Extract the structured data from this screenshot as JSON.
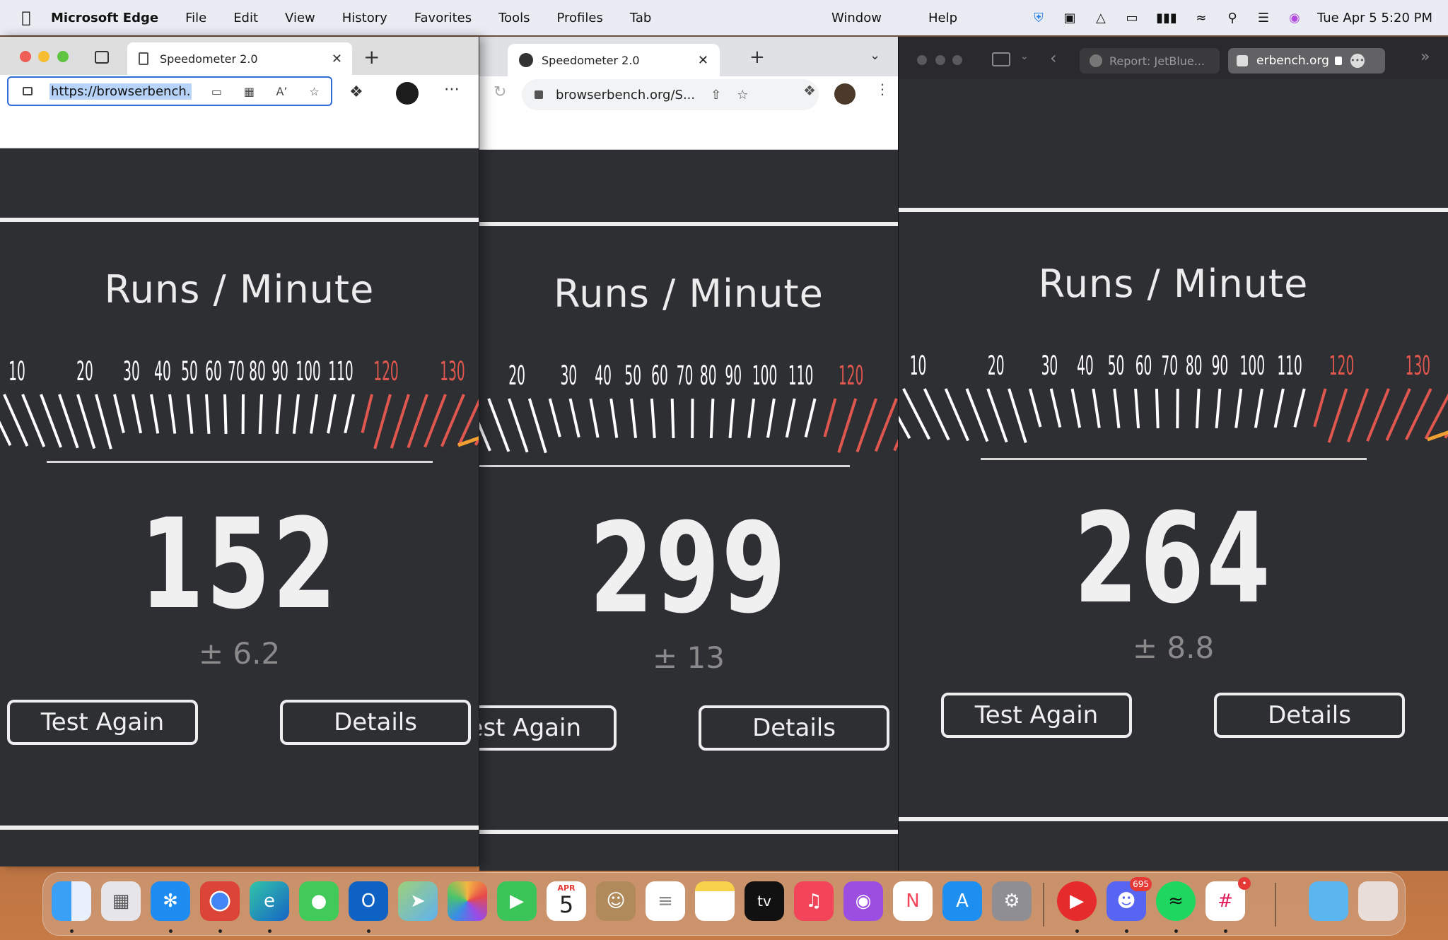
{
  "menubar": {
    "app_name": "Microsoft Edge",
    "menus": [
      "File",
      "Edit",
      "View",
      "History",
      "Favorites",
      "Tools",
      "Profiles",
      "Tab"
    ],
    "menus_right": [
      "Window",
      "Help"
    ],
    "clock": "Tue Apr 5  5:20 PM"
  },
  "edge": {
    "tab_title": "Speedometer 2.0",
    "url": "https://browserbench."
  },
  "chrome": {
    "tab_title": "Speedometer 2.0",
    "url": "browserbench.org/S..."
  },
  "safari": {
    "tab1_title": "Report: JetBlue...",
    "tab2_title": "erbench.org"
  },
  "speedometer": {
    "title": "Runs / Minute",
    "gauge_ticks": [
      "10",
      "20",
      "30",
      "40",
      "50",
      "60",
      "70",
      "80",
      "90",
      "100",
      "110",
      "120",
      "130"
    ],
    "gauge_colors": {
      "normal": "#ffffff",
      "high": "#e0574f",
      "needle": "#f0a030"
    },
    "results": [
      {
        "browser": "edge",
        "score": "152",
        "error": "± 6.2",
        "test_again": "Test Again",
        "details": "Details"
      },
      {
        "browser": "chrome",
        "score": "299",
        "error": "± 13",
        "test_again": "Test Again",
        "details": "Details"
      },
      {
        "browser": "safari",
        "score": "264",
        "error": "± 8.8",
        "test_again": "Test Again",
        "details": "Details"
      }
    ]
  },
  "dock": {
    "calendar_month": "APR",
    "calendar_day": "5",
    "discord_badge": "695",
    "apps": [
      "finder",
      "launchpad",
      "safari",
      "chrome",
      "edge",
      "messages",
      "outlook",
      "maps",
      "photos",
      "facetime",
      "calendar",
      "contacts",
      "reminders",
      "notes",
      "apple-tv",
      "music",
      "podcasts",
      "news",
      "app-store",
      "system-preferences",
      "youtube-music",
      "discord",
      "spotify",
      "slack",
      "downloads-folder",
      "trash"
    ]
  }
}
